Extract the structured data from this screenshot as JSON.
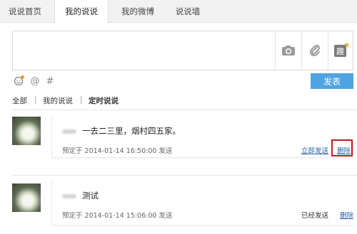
{
  "tabs": [
    {
      "label": "说说首页",
      "active": false
    },
    {
      "label": "我的说说",
      "active": true
    },
    {
      "label": "我的微博",
      "active": false
    },
    {
      "label": "说说墙",
      "active": false
    }
  ],
  "composer": {
    "text": "",
    "tools": [
      "camera-icon",
      "paperclip-icon",
      "qu-badge-icon"
    ],
    "emoji_icons": [
      "emoji-icon",
      "at-icon",
      "hash-icon"
    ],
    "post_label": "发表",
    "accent": "#4fa4e3"
  },
  "filters": {
    "items": [
      "全部",
      "我的说说",
      "定时说说"
    ],
    "separator": "|",
    "active": "定时说说"
  },
  "posts": [
    {
      "content": "一去二三里，烟村四五家。",
      "meta": "预定于 2014-01-14 16:50:00 发送",
      "action_primary": "立即发送",
      "action_delete": "删除",
      "highlight_delete": true
    },
    {
      "content": "测试",
      "meta": "预定于 2014-01-14 15:06:00 发送",
      "action_primary": "已经发送",
      "action_delete": "删除",
      "highlight_delete": false
    }
  ],
  "colors": {
    "link": "#2a63b3",
    "highlight": "#c8161d"
  }
}
